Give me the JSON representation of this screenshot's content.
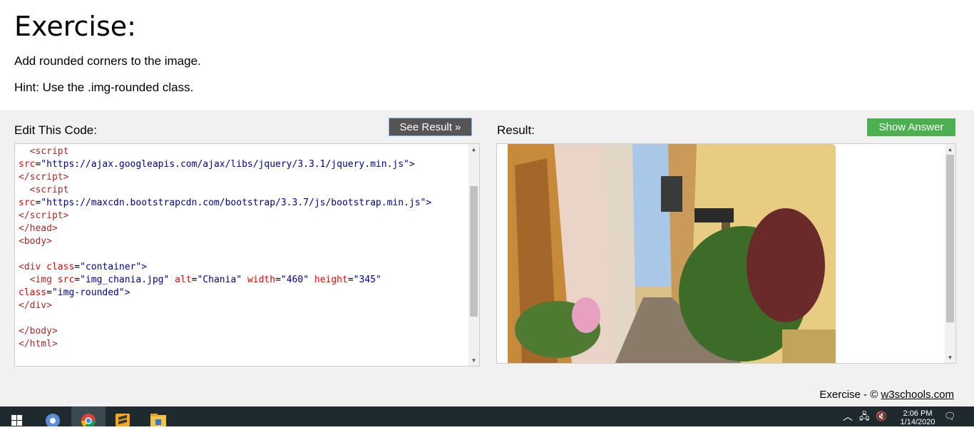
{
  "header": {
    "title": "Exercise:",
    "instruction": "Add rounded corners to the image.",
    "hint": "Hint: Use the .img-rounded class."
  },
  "editor": {
    "label": "Edit This Code:",
    "see_result_label": "See Result »",
    "scroll": {
      "position": 0.45,
      "visible_fraction": 0.65
    }
  },
  "result": {
    "label": "Result:",
    "show_answer_label": "Show Answer",
    "image_alt": "Chania",
    "scroll": {
      "position": 0.0,
      "visible_fraction": 0.85
    }
  },
  "footer": {
    "prefix": "Exercise - ©",
    "link": "w3schools.com"
  },
  "taskbar": {
    "icons": [
      "windows-start-icon",
      "chromium-icon",
      "chrome-icon",
      "sublime-text-icon",
      "file-explorer-icon"
    ],
    "time": "2:06 PM",
    "date": "1/14/2020"
  },
  "colors": {
    "see_result_bg": "#555555",
    "show_answer_bg": "#4caf50",
    "tag": "#a52a2a",
    "attribute": "#ee0000",
    "value": "#00008b",
    "taskbar": "#1f2a2e"
  }
}
